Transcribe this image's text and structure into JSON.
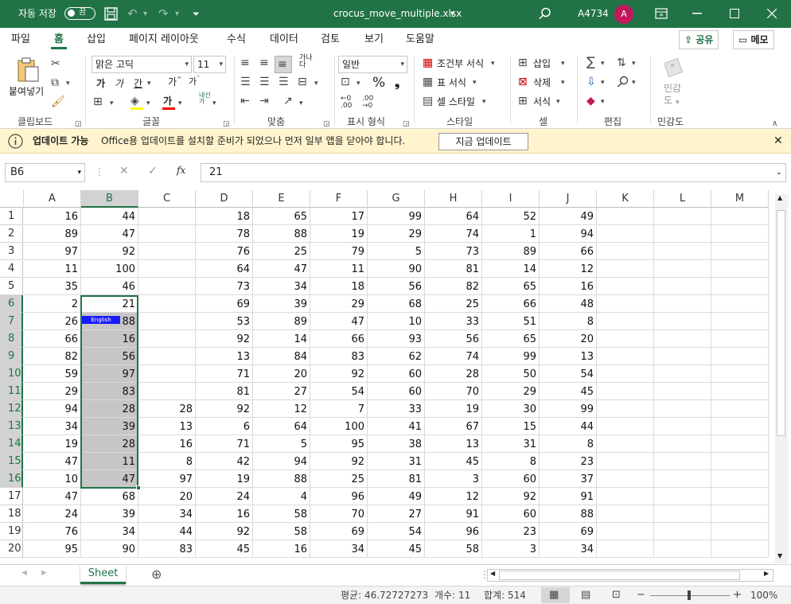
{
  "titlebar": {
    "autosave_label": "자동 저장",
    "autosave_state": "끔",
    "filename": "crocus_move_multiple.xlsx",
    "filename_caret": "▾",
    "account_name": "A4734",
    "avatar_initial": "A"
  },
  "tabs": [
    "파일",
    "홈",
    "삽입",
    "페이지 레이아웃",
    "수식",
    "데이터",
    "검토",
    "보기",
    "도움말"
  ],
  "active_tab": "홈",
  "share_label": "공유",
  "comment_label": "메모",
  "ribbon": {
    "paste_label": "붙여넣기",
    "font_name": "맑은 고딕",
    "font_size": "11",
    "number_format": "일반",
    "cond_format": "조건부 서식",
    "table_format": "표 서식",
    "cell_style": "셀 스타일",
    "insert": "삽입",
    "delete": "삭제",
    "format": "서식",
    "sensitivity": "민감\n도",
    "groups": {
      "clipboard": "클립보드",
      "font": "글꼴",
      "alignment": "맞춤",
      "number": "표시 형식",
      "styles": "스타일",
      "cells": "셀",
      "editing": "편집",
      "sensitivity": "민감도"
    }
  },
  "infobar": {
    "title": "업데이트 가능",
    "message": "Office용 업데이트를 설치할 준비가 되었으나 먼저 일부 앱을 닫아야 합니다.",
    "button": "지금 업데이트"
  },
  "formula_bar": {
    "name_box": "B6",
    "fx": "fx",
    "value": "21"
  },
  "ime_badge": "English",
  "columns": [
    "A",
    "B",
    "C",
    "D",
    "E",
    "F",
    "G",
    "H",
    "I",
    "J",
    "K",
    "L",
    "M"
  ],
  "selected_column": "B",
  "selected_rows": [
    6,
    16
  ],
  "rows": [
    {
      "r": "1",
      "c": [
        "16",
        "44",
        "",
        "18",
        "65",
        "17",
        "99",
        "64",
        "52",
        "49"
      ]
    },
    {
      "r": "2",
      "c": [
        "89",
        "47",
        "",
        "78",
        "88",
        "19",
        "29",
        "74",
        "1",
        "94"
      ]
    },
    {
      "r": "3",
      "c": [
        "97",
        "92",
        "",
        "76",
        "25",
        "79",
        "5",
        "73",
        "89",
        "66"
      ]
    },
    {
      "r": "4",
      "c": [
        "11",
        "100",
        "",
        "64",
        "47",
        "11",
        "90",
        "81",
        "14",
        "12"
      ]
    },
    {
      "r": "5",
      "c": [
        "35",
        "46",
        "",
        "73",
        "34",
        "18",
        "56",
        "82",
        "65",
        "16"
      ]
    },
    {
      "r": "6",
      "c": [
        "2",
        "21",
        "",
        "69",
        "39",
        "29",
        "68",
        "25",
        "66",
        "48"
      ]
    },
    {
      "r": "7",
      "c": [
        "26",
        "88",
        "",
        "53",
        "89",
        "47",
        "10",
        "33",
        "51",
        "8"
      ]
    },
    {
      "r": "8",
      "c": [
        "66",
        "16",
        "",
        "92",
        "14",
        "66",
        "93",
        "56",
        "65",
        "20"
      ]
    },
    {
      "r": "9",
      "c": [
        "82",
        "56",
        "",
        "13",
        "84",
        "83",
        "62",
        "74",
        "99",
        "13"
      ]
    },
    {
      "r": "10",
      "c": [
        "59",
        "97",
        "",
        "71",
        "20",
        "92",
        "60",
        "28",
        "50",
        "54"
      ]
    },
    {
      "r": "11",
      "c": [
        "29",
        "83",
        "",
        "81",
        "27",
        "54",
        "60",
        "70",
        "29",
        "45"
      ]
    },
    {
      "r": "12",
      "c": [
        "94",
        "28",
        "28",
        "92",
        "12",
        "7",
        "33",
        "19",
        "30",
        "99"
      ]
    },
    {
      "r": "13",
      "c": [
        "34",
        "39",
        "13",
        "6",
        "64",
        "100",
        "41",
        "67",
        "15",
        "44"
      ]
    },
    {
      "r": "14",
      "c": [
        "19",
        "28",
        "16",
        "71",
        "5",
        "95",
        "38",
        "13",
        "31",
        "8"
      ]
    },
    {
      "r": "15",
      "c": [
        "47",
        "11",
        "8",
        "42",
        "94",
        "92",
        "31",
        "45",
        "8",
        "23"
      ]
    },
    {
      "r": "16",
      "c": [
        "10",
        "47",
        "97",
        "19",
        "88",
        "25",
        "81",
        "3",
        "60",
        "37"
      ]
    },
    {
      "r": "17",
      "c": [
        "47",
        "68",
        "20",
        "24",
        "4",
        "96",
        "49",
        "12",
        "92",
        "91"
      ]
    },
    {
      "r": "18",
      "c": [
        "24",
        "39",
        "34",
        "16",
        "58",
        "70",
        "27",
        "91",
        "60",
        "88"
      ]
    },
    {
      "r": "19",
      "c": [
        "76",
        "34",
        "44",
        "92",
        "58",
        "69",
        "54",
        "96",
        "23",
        "69"
      ]
    },
    {
      "r": "20",
      "c": [
        "95",
        "90",
        "83",
        "45",
        "16",
        "34",
        "45",
        "58",
        "3",
        "34"
      ]
    }
  ],
  "sheet_tab": "Sheet",
  "status": {
    "average": "평균: 46.72727273",
    "count": "개수: 11",
    "sum": "합계: 514",
    "zoom": "100%"
  },
  "colors": {
    "accent": "#217346",
    "info_bg": "#fff4ce",
    "selection": "#c6c6c6"
  }
}
